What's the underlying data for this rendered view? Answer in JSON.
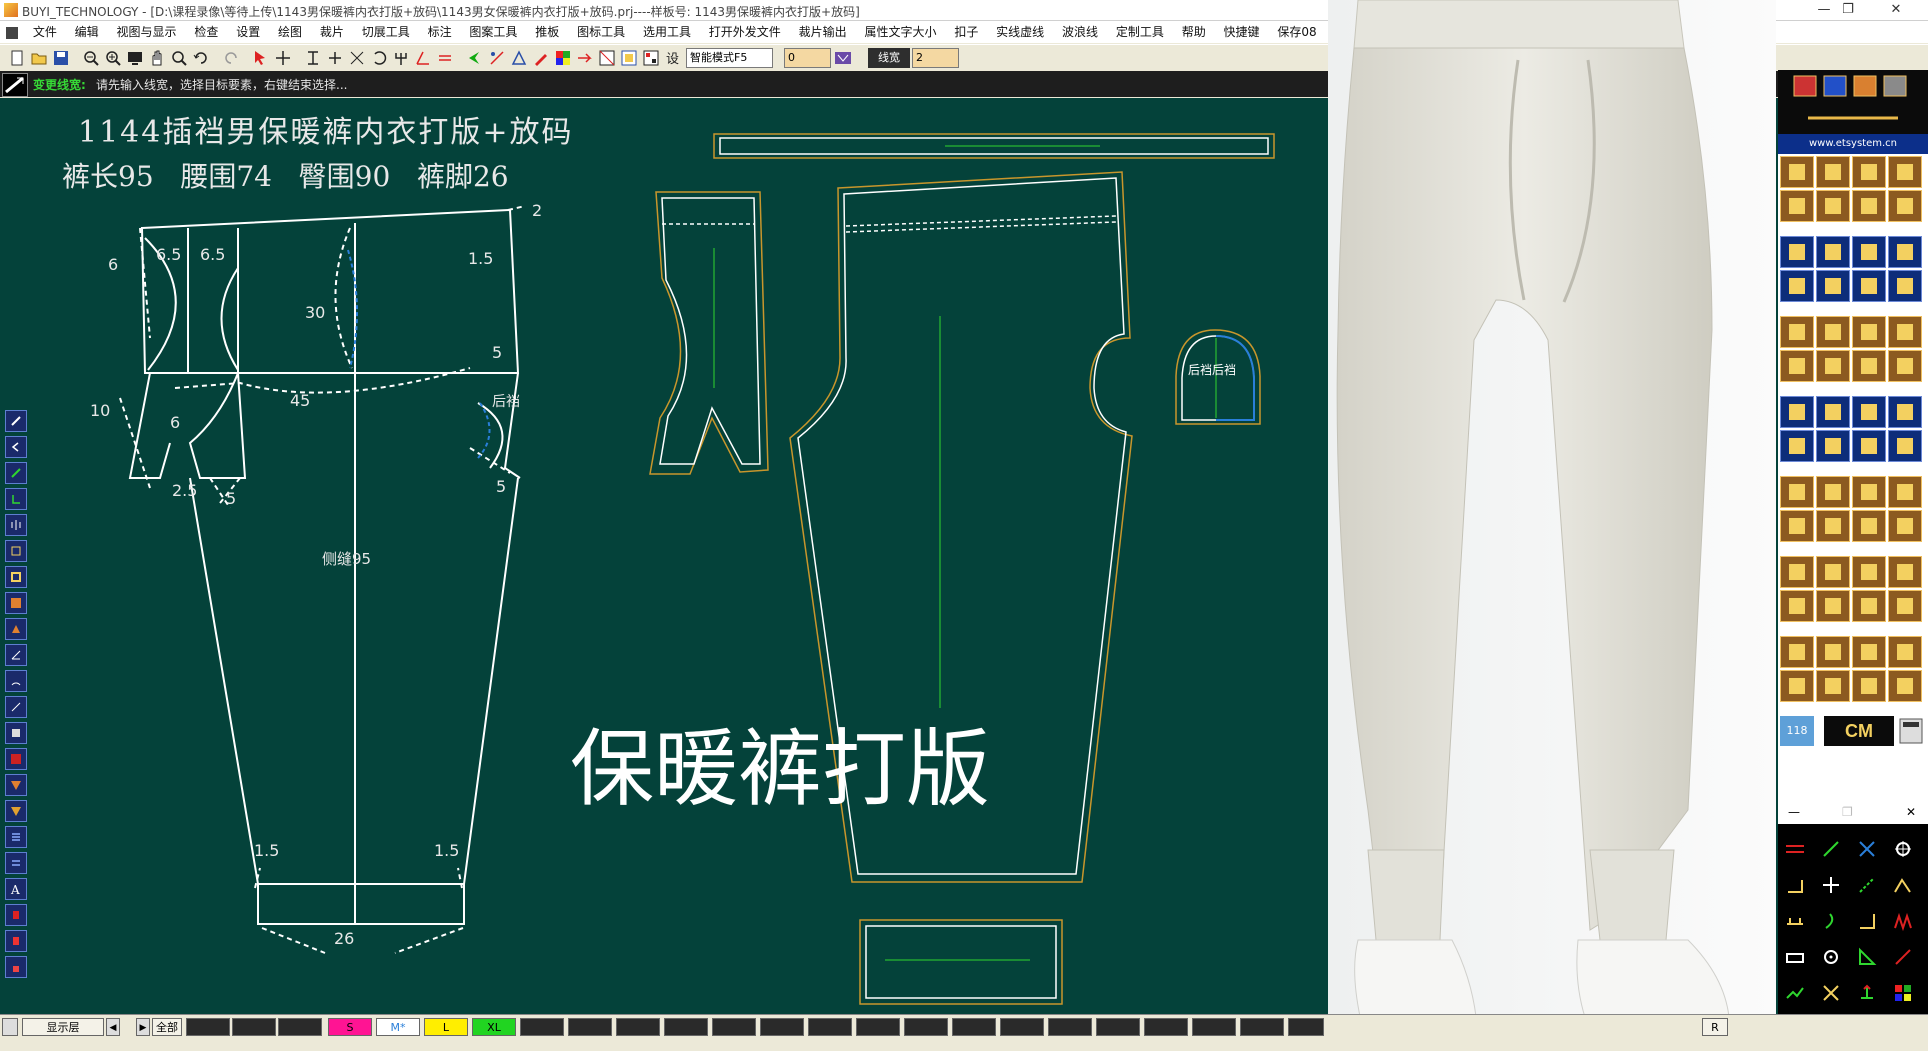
{
  "window": {
    "title": "BUYI_TECHNOLOGY - [D:\\课程录像\\等待上传\\1143男保暖裤内衣打版+放码\\1143男女保暖裤内衣打版+放码.prj----样板号: 1143男保暖裤内衣打版+放码]",
    "minimize_glyph": "—",
    "restore_glyph": "❐",
    "close_glyph": "✕"
  },
  "menu": {
    "items": [
      "文件",
      "编辑",
      "视图与显示",
      "检查",
      "设置",
      "绘图",
      "裁片",
      "切展工具",
      "标注",
      "图案工具",
      "推板",
      "图标工具",
      "选用工具",
      "打开外发文件",
      "裁片输出",
      "属性文字大小",
      "扣子",
      "实线虚线",
      "波浪线",
      "定制工具",
      "帮助",
      "快捷键",
      "保存08"
    ]
  },
  "toolbar": {
    "mode_select": "智能模式F5",
    "number_value": "0",
    "line_width_label": "线宽",
    "line_width_value": "2"
  },
  "status": {
    "command": "变更线宽:",
    "message": "请先输入线宽，选择目标要素，右键结束选择..."
  },
  "canvas": {
    "title_line1": "1144插裆男保暖裤内衣打版+放码",
    "title_line2": "裤长95   腰围74   臀围90   裤脚26",
    "watermark": "保暖裤打版",
    "labels": {
      "side_seam": "侧缝95",
      "crotch": "后裆",
      "gusset_piece": "后裆后裆",
      "n6_65a": "6.5",
      "n6_65b": "6.5",
      "n_6": "6",
      "n_15": "1.5",
      "n_2": "2",
      "n_30": "30",
      "n_5a": "5",
      "n_45": "45",
      "n_10": "10",
      "n_6b": "6",
      "n_25": "2.5",
      "n_5b": "5",
      "n_5c": "5",
      "n_15b": "1.5",
      "n_15c": "1.5",
      "n_26": "26"
    }
  },
  "rightpanel": {
    "website": "www.etsystem.cn",
    "cm_label": "CM",
    "num_label": "118"
  },
  "bottombar": {
    "layer_label": "显示层",
    "all_label": "全部",
    "sizes": [
      {
        "label": "S",
        "color": "#ff1493"
      },
      {
        "label": "M*",
        "color": "#ffffff"
      },
      {
        "label": "L",
        "color": "#ffee00"
      },
      {
        "label": "XL",
        "color": "#21d421"
      }
    ],
    "right_label": "R"
  },
  "colors": {
    "canvas_bg": "#04423a",
    "pattern_line": "#ffffff",
    "seam_allowance": "#c8962c",
    "grain_line": "#2fd62f",
    "blue_curve": "#2a7fd9"
  }
}
